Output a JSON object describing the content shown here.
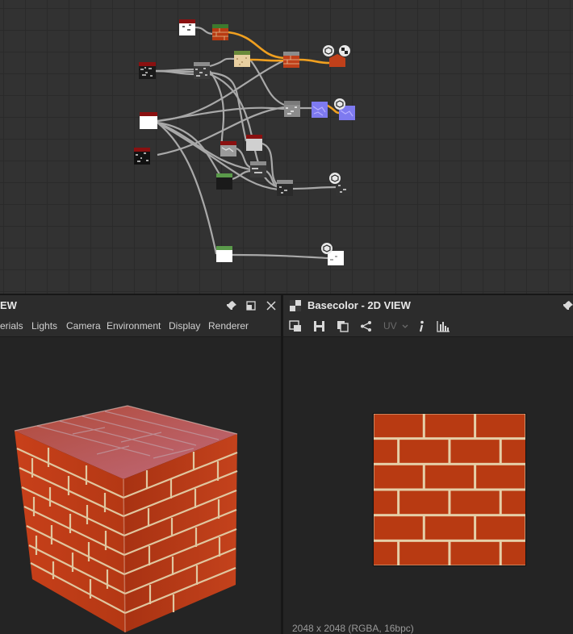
{
  "graph": {
    "nodes": [
      {
        "name": "node-white-pattern-a"
      },
      {
        "name": "node-brick-shape"
      },
      {
        "name": "node-noise-1"
      },
      {
        "name": "node-noise-2"
      },
      {
        "name": "node-sand-texture"
      },
      {
        "name": "node-blend-output"
      },
      {
        "name": "node-basecolor-output"
      },
      {
        "name": "node-white-mask"
      },
      {
        "name": "node-normal-blend"
      },
      {
        "name": "node-normal-map"
      },
      {
        "name": "node-normal-output"
      },
      {
        "name": "node-grunge-black"
      },
      {
        "name": "node-rock-texture"
      },
      {
        "name": "node-grey-mask"
      },
      {
        "name": "node-dark-node"
      },
      {
        "name": "node-levels"
      },
      {
        "name": "node-roughness-mix"
      },
      {
        "name": "node-roughness-output"
      },
      {
        "name": "node-white-solid"
      },
      {
        "name": "node-height-output"
      }
    ]
  },
  "panel3d": {
    "title": "EW",
    "menu": [
      "erials",
      "Lights",
      "Camera",
      "Environment",
      "Display",
      "Renderer"
    ],
    "icons": {
      "pin": "pin-icon",
      "maximize": "maximize-icon",
      "close": "close-icon"
    }
  },
  "panel2d": {
    "title": "Basecolor - 2D VIEW",
    "uv_label": "UV",
    "status": "2048 x 2048 (RGBA, 16bpc)",
    "icons": {
      "fit": "fit-view-icon",
      "save": "save-icon",
      "copy": "copy-icon",
      "share": "share-icon",
      "info": "info-icon",
      "histogram": "histogram-icon",
      "pin": "pin-icon"
    }
  },
  "colors": {
    "brick": "#b83a12",
    "mortar": "#e8d2b0",
    "accent_wire": "#f0a020",
    "wire": "#a8a8a8"
  }
}
